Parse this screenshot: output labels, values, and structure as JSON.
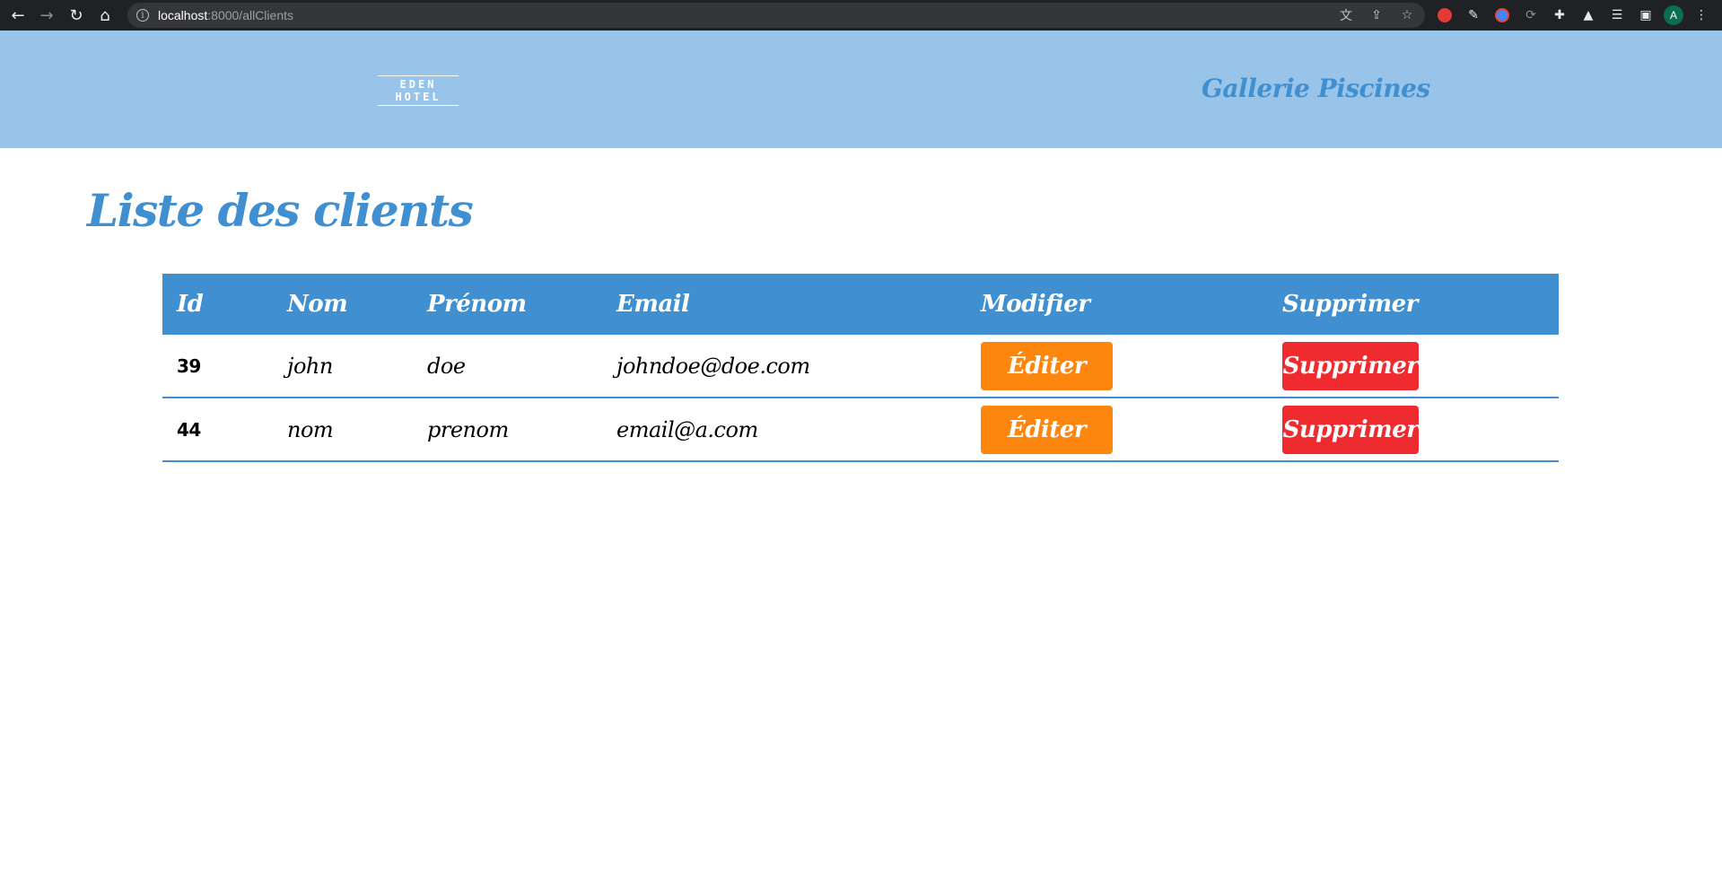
{
  "browser": {
    "url_host": "localhost",
    "url_path": ":8000/allClients"
  },
  "header": {
    "logo_text": "EDEN HOTEL",
    "gallery_link": "Gallerie Piscines"
  },
  "main": {
    "title": "Liste des clients",
    "columns": [
      "Id",
      "Nom",
      "Prénom",
      "Email",
      "Modifier",
      "Supprimer"
    ],
    "rows": [
      {
        "id": "39",
        "nom": "john",
        "prenom": "doe",
        "email": "johndoe@doe.com",
        "edit_label": "Éditer",
        "delete_label": "Supprimer"
      },
      {
        "id": "44",
        "nom": "nom",
        "prenom": "prenom",
        "email": "email@a.com",
        "edit_label": "Éditer",
        "delete_label": "Supprimer"
      }
    ]
  },
  "colors": {
    "header_bg": "#97c4e8",
    "accent": "#3f8fd1",
    "edit": "#fd860f",
    "delete": "#f02b30"
  },
  "icons": {
    "extensions": [
      "translate-icon",
      "share-icon",
      "star-icon",
      "red-extension-icon",
      "pen-icon",
      "chrome-ball-icon",
      "sync-icon",
      "puzzle-icon",
      "flask-icon",
      "playlist-icon",
      "sidebar-icon"
    ],
    "avatar_letter": "A"
  }
}
